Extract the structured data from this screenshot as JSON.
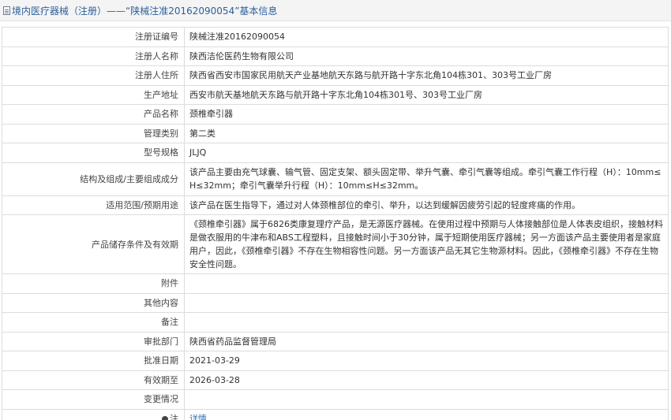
{
  "header": {
    "title": "境内医疗器械（注册）——“陕械注准20162090054”基本信息"
  },
  "rows": [
    {
      "label": "注册证编号",
      "value": "陕械注准20162090054"
    },
    {
      "label": "注册人名称",
      "value": "陕西洁伦医药生物有限公司"
    },
    {
      "label": "注册人住所",
      "value": "陕西省西安市国家民用航天产业基地航天东路与航开路十字东北角104栋301、303号工业厂房"
    },
    {
      "label": "生产地址",
      "value": "西安市航天基地航天东路与航开路十字东北角104栋301号、303号工业厂房"
    },
    {
      "label": "产品名称",
      "value": "颈椎牵引器"
    },
    {
      "label": "管理类别",
      "value": "第二类"
    },
    {
      "label": "型号规格",
      "value": "JLJQ"
    },
    {
      "label": "结构及组成/主要组成成分",
      "value": "该产品主要由充气球囊、输气管、固定支架、额头固定带、举升气囊、牵引气囊等组成。牵引气囊工作行程（H）：10mm≤H≤32mm；牵引气囊举升行程（H）：10mm≤H≤32mm。"
    },
    {
      "label": "适用范围/预期用途",
      "value": "该产品在医生指导下，通过对人体颈椎部位的牵引、举升，以达到缓解因疲劳引起的轻度疼痛的作用。"
    },
    {
      "label": "产品储存条件及有效期",
      "value": "《颈椎牵引器》属于6826类康复理疗产品，是无源医疗器械。在使用过程中预期与人体接触部位是人体表皮组织，接触材料是做衣服用的牛津布和ABS工程塑料，且接触时间小于30分钟，属于短期使用医疗器械；另一方面该产品主要使用者是家庭用户，因此，《颈椎牵引器》不存在生物相容性问题。另一方面该产品无其它生物源材料。因此，《颈椎牵引器》不存在生物安全性问题。"
    },
    {
      "label": "附件",
      "value": ""
    },
    {
      "label": "其他内容",
      "value": ""
    },
    {
      "label": "备注",
      "value": ""
    },
    {
      "label": "审批部门",
      "value": "陕西省药品监督管理局"
    },
    {
      "label": "批准日期",
      "value": "2021-03-29"
    },
    {
      "label": "有效期至",
      "value": "2026-03-28"
    },
    {
      "label": "变更情况",
      "value": ""
    }
  ],
  "note_row": {
    "label": "注",
    "link_text": "详情"
  }
}
